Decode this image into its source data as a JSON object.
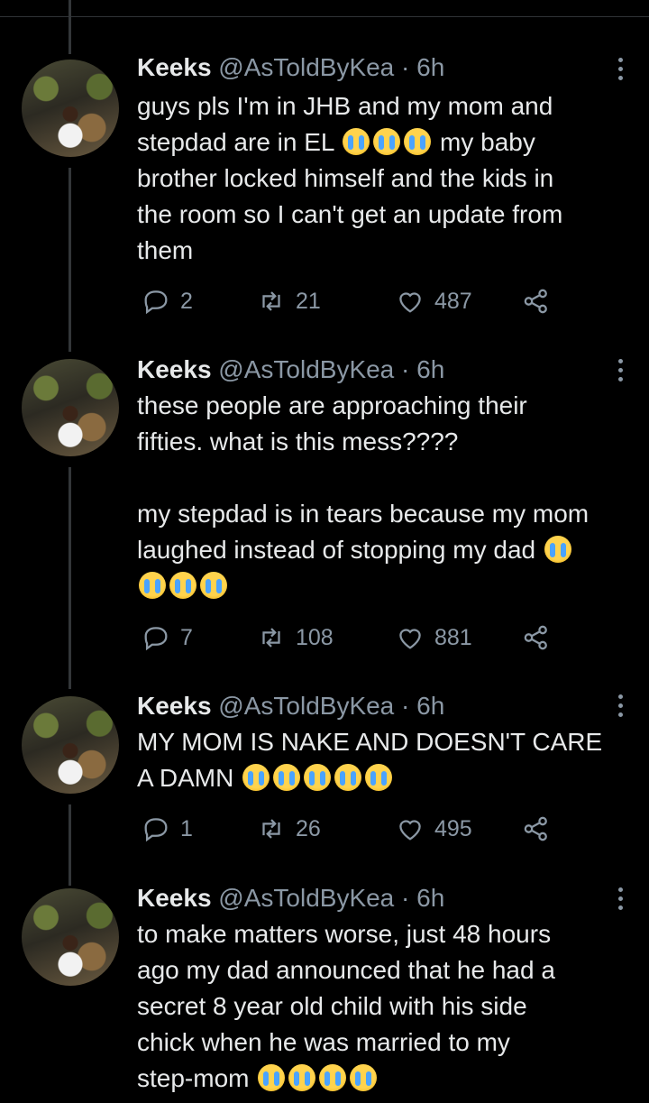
{
  "tweets": [
    {
      "name": "Keeks",
      "handle": "@AsToldByKea",
      "separator": "·",
      "time": "6h",
      "text_parts": [
        "guys pls I'm in JHB and my mom and\nstepdad are in EL ",
        " my baby\nbrother locked himself and the kids in\nthe room so I can't get an update from\nthem"
      ],
      "emoji_count": 3,
      "replies": "2",
      "retweets": "21",
      "likes": "487"
    },
    {
      "name": "Keeks",
      "handle": "@AsToldByKea",
      "separator": "·",
      "time": "6h",
      "text_parts": [
        "these people are approaching their\nfifties. what is this mess????\n\nmy stepdad is in tears because my mom\nlaughed instead of stopping my dad ",
        ""
      ],
      "emoji_count": 4,
      "replies": "7",
      "retweets": "108",
      "likes": "881"
    },
    {
      "name": "Keeks",
      "handle": "@AsToldByKea",
      "separator": "·",
      "time": "6h",
      "text_parts": [
        "MY MOM IS NAKE AND DOESN'T CARE\nA DAMN ",
        ""
      ],
      "emoji_count": 5,
      "replies": "1",
      "retweets": "26",
      "likes": "495"
    },
    {
      "name": "Keeks",
      "handle": "@AsToldByKea",
      "separator": "·",
      "time": "6h",
      "text_parts": [
        "to make matters worse, just 48 hours\nago my dad announced that he had a\nsecret 8 year old child with his side\nchick when he was married to my\nstep-mom ",
        ""
      ],
      "emoji_count": 4
    }
  ],
  "icons": {
    "emoji": "loudly-crying-face",
    "reply": "reply-icon",
    "retweet": "retweet-icon",
    "like": "heart-icon",
    "share": "share-icon",
    "menu": "more-options-icon"
  },
  "colors": {
    "background": "#000000",
    "text": "#e7e9ea",
    "muted": "#8b98a5"
  }
}
